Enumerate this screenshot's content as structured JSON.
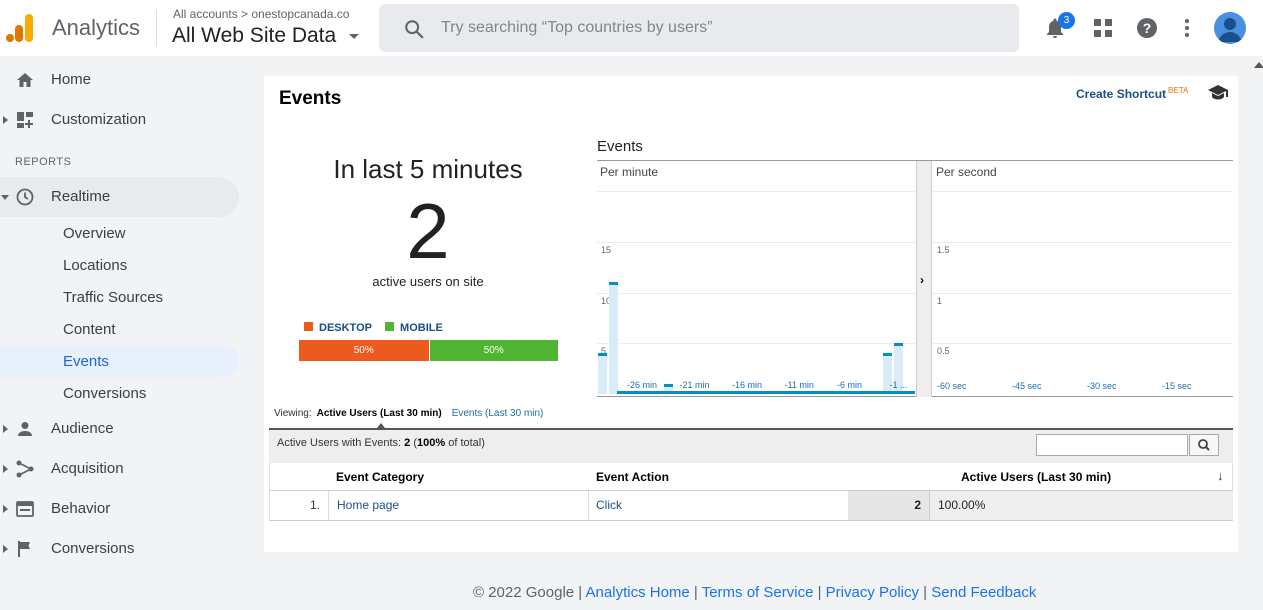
{
  "header": {
    "app_name": "Analytics",
    "account_path": "All accounts > onestopcanada.co",
    "view_name": "All Web Site Data",
    "search_placeholder": "Try searching “Top countries by users”",
    "notification_count": "3",
    "brand_colors": {
      "logo_bar_orange": "#f9ab00",
      "logo_bar_dark": "#e37400",
      "accent": "#1a73e8"
    }
  },
  "sidebar": {
    "home": "Home",
    "customization": "Customization",
    "reports_label": "REPORTS",
    "realtime": "Realtime",
    "realtime_items": [
      "Overview",
      "Locations",
      "Traffic Sources",
      "Content",
      "Events",
      "Conversions"
    ],
    "active_item": "Events",
    "audience": "Audience",
    "acquisition": "Acquisition",
    "behavior": "Behavior",
    "conversions": "Conversions"
  },
  "panel": {
    "title": "Events",
    "create_shortcut": "Create Shortcut",
    "beta": "BETA",
    "in_last": "In last 5 minutes",
    "active_count": "2",
    "active_label": "active users on site",
    "device_legend": [
      {
        "label": "DESKTOP",
        "color": "#ec5a1d"
      },
      {
        "label": "MOBILE",
        "color": "#50b432"
      }
    ],
    "device_split": [
      {
        "label": "50%",
        "share": 0.5,
        "color": "#ec5a1d"
      },
      {
        "label": "50%",
        "share": 0.5,
        "color": "#50b432"
      }
    ]
  },
  "chart_data": {
    "type": "bar",
    "title": "Events",
    "per_minute": {
      "subtitle": "Per minute",
      "y_ticks": [
        "15",
        "10",
        "5"
      ],
      "ylim": [
        0,
        20
      ],
      "x_ticks": [
        "-26 min",
        "-21 min",
        "-16 min",
        "-11 min",
        "-6 min",
        "-1 ..."
      ],
      "values": [
        4,
        11,
        0,
        0,
        0,
        0,
        1,
        0,
        0,
        0,
        0,
        0,
        0,
        0,
        0,
        0,
        0,
        0,
        0,
        0,
        0,
        0,
        0,
        0,
        0,
        0,
        4,
        5,
        0
      ]
    },
    "per_second": {
      "subtitle": "Per second",
      "y_ticks": [
        "1.5",
        "1",
        "0.5"
      ],
      "ylim": [
        0,
        2
      ],
      "x_ticks": [
        "-60 sec",
        "-45 sec",
        "-30 sec",
        "-15 sec"
      ],
      "values": []
    }
  },
  "viewing": {
    "label": "Viewing:",
    "active": "Active Users (Last 30 min)",
    "other": "Events (Last 30 min)"
  },
  "table": {
    "summary_label": "Active Users with Events:",
    "summary_value": "2",
    "summary_pct": "100%",
    "summary_suffix": "of total)",
    "filter_value": "",
    "columns": [
      "Event Category",
      "Event Action",
      "Active Users (Last 30 min)"
    ],
    "rows": [
      {
        "num": "1.",
        "category": "Home page",
        "action": "Click",
        "users": "2",
        "pct": "100.00%"
      }
    ]
  },
  "footer": {
    "copyright": "© 2022 Google |",
    "links": [
      "Analytics Home",
      "Terms of Service",
      "Privacy Policy",
      "Send Feedback"
    ]
  }
}
